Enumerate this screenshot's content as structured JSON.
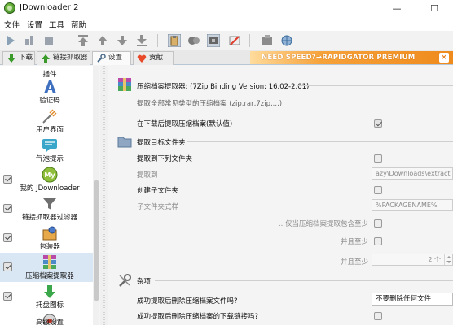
{
  "window": {
    "title": "JDownloader 2",
    "minimize": "—",
    "maximize": "☐"
  },
  "menu": {
    "items": [
      "文件",
      "设置",
      "工具",
      "帮助"
    ]
  },
  "toolbar": {
    "icons": [
      "play-icon",
      "pause-icon",
      "stop-icon",
      "move-top-icon",
      "move-up-icon",
      "move-down-icon",
      "move-bottom-icon",
      "clipboard-icon",
      "premium-icon",
      "reconnect-icon",
      "auto-update-icon",
      "settings-gear-icon",
      "globe-icon"
    ]
  },
  "tabs": [
    {
      "label": "下载",
      "icon": "download-arrow-icon"
    },
    {
      "label": "链接抓取器",
      "icon": "link-grabber-icon"
    },
    {
      "label": "设置",
      "icon": "settings-wrench-icon"
    },
    {
      "label": "贡献",
      "icon": "heart-icon"
    }
  ],
  "promo": {
    "text": "NEED SPEED?→RAPIDGATOR PREMIUM"
  },
  "sidebar": {
    "items": [
      {
        "label": "插件",
        "icon": "plugin-icon",
        "checked": false
      },
      {
        "label": "验证码",
        "icon": "captcha-icon",
        "checked": false
      },
      {
        "label": "用户界面",
        "icon": "user-interface-icon",
        "checked": false
      },
      {
        "label": "气泡提示",
        "icon": "bubble-icon",
        "checked": false
      },
      {
        "label": "我的 JDownloader",
        "icon": "my-jdownloader-icon",
        "checked": true
      },
      {
        "label": "链接抓取器过滤器",
        "icon": "linkgrabber-filter-icon",
        "checked": true
      },
      {
        "label": "包装器",
        "icon": "packager-icon",
        "checked": true
      },
      {
        "label": "压缩档案提取器",
        "icon": "archive-extractor-icon",
        "checked": true
      },
      {
        "label": "托盘图标",
        "icon": "tray-icon",
        "checked": true
      },
      {
        "label": "高级设置",
        "icon": "advanced-settings-icon",
        "checked": false
      }
    ]
  },
  "extractor": {
    "title": "压缩档案提取器: (7Zip Binding Version: 16.02-2.01)",
    "description": "提取全部常见类型的压缩档案 (zip,rar,7zip,...)",
    "extract_after_download_label": "在下载后提取压缩档案(默认值)",
    "extract_after_download_checked": true
  },
  "target": {
    "title": "提取目标文件夹",
    "extract_to_folder_label": "提取到下列文件夹",
    "extract_to_folder_checked": false,
    "extract_to_label": "提取到",
    "extract_to_value": "azy\\Downloads\\extract",
    "create_subfolder_label": "创建子文件夹",
    "create_subfolder_checked": false,
    "subfolder_pattern_label": "子文件夹式样",
    "subfolder_pattern_value": "%PACKAGENAME%",
    "only_if_more_label": "...仅当压缩档案提取包含至少",
    "only_if_more_checked": false,
    "and_at_least_1_label": "并且至少",
    "and_at_least_1_checked": false,
    "and_at_least_2_label": "并且至少",
    "and_at_least_2_checked": false,
    "and_at_least_2_value": "2 个"
  },
  "misc": {
    "title": "杂项",
    "delete_archives_label": "成功提取后删除压缩档案文件吗?",
    "delete_archives_value": "不要删除任何文件",
    "delete_links_label": "成功提取后删除压缩档案的下载链接吗?",
    "delete_links_checked": false
  }
}
